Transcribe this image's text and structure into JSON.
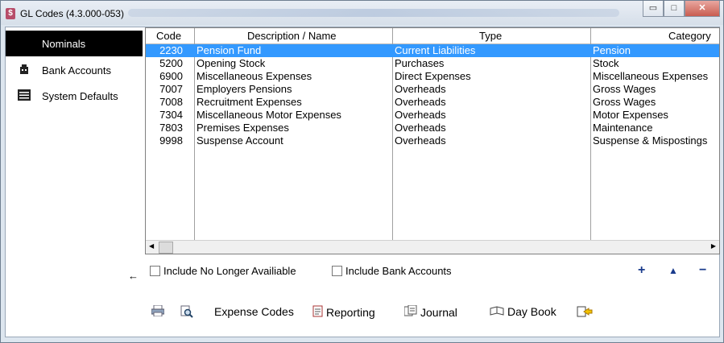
{
  "window": {
    "title": "GL Codes (4.3.000-053)",
    "app_icon": "$"
  },
  "sidebar": {
    "items": [
      {
        "label": "Nominals",
        "icon": "",
        "active": true
      },
      {
        "label": "Bank Accounts",
        "icon": "bank-icon",
        "active": false
      },
      {
        "label": "System Defaults",
        "icon": "list-icon",
        "active": false
      }
    ]
  },
  "table": {
    "columns": [
      "Code",
      "Description / Name",
      "Type",
      "Category"
    ],
    "rows": [
      {
        "code": "2230",
        "desc": "Pension Fund",
        "type": "Current Liabilities",
        "category": "Pension",
        "selected": true
      },
      {
        "code": "5200",
        "desc": "Opening Stock",
        "type": "Purchases",
        "category": "Stock"
      },
      {
        "code": "6900",
        "desc": "Miscellaneous Expenses",
        "type": "Direct Expenses",
        "category": "Miscellaneous Expenses"
      },
      {
        "code": "7007",
        "desc": "Employers Pensions",
        "type": "Overheads",
        "category": "Gross Wages"
      },
      {
        "code": "7008",
        "desc": "Recruitment Expenses",
        "type": "Overheads",
        "category": "Gross Wages"
      },
      {
        "code": "7304",
        "desc": "Miscellaneous Motor Expenses",
        "type": "Overheads",
        "category": "Motor Expenses"
      },
      {
        "code": "7803",
        "desc": "Premises Expenses",
        "type": "Overheads",
        "category": "Maintenance"
      },
      {
        "code": "9998",
        "desc": "Suspense Account",
        "type": "Overheads",
        "category": "Suspense & Mispostings"
      }
    ]
  },
  "options": {
    "include_no_longer": "Include No Longer Availiable",
    "include_bank": "Include Bank Accounts",
    "add": "+",
    "edit": "▲",
    "remove": "−"
  },
  "bottom": {
    "expense_codes": "Expense Codes",
    "reporting": "Reporting",
    "journal": "Journal",
    "day_book": "Day Book"
  },
  "back_arrow": "←"
}
